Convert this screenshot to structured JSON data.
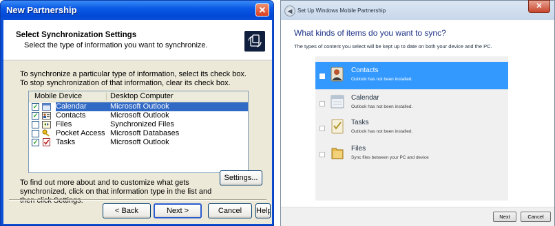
{
  "xp": {
    "title": "New Partnership",
    "close": "✕",
    "header_title": "Select Synchronization Settings",
    "header_subtitle": "Select the type of information you want to synchronize.",
    "instructions": "To synchronize a particular type of information, select its check box. To stop synchronization of that information, clear its check box.",
    "columns": [
      "Mobile Device",
      "Desktop Computer"
    ],
    "rows": [
      {
        "name": "Calendar",
        "app": "Microsoft Outlook",
        "checked": true,
        "selected": true,
        "icon": "calendar-icon"
      },
      {
        "name": "Contacts",
        "app": "Microsoft Outlook",
        "checked": true,
        "selected": false,
        "icon": "contacts-icon"
      },
      {
        "name": "Files",
        "app": "Synchronized Files",
        "checked": false,
        "selected": false,
        "icon": "files-icon"
      },
      {
        "name": "Pocket Access",
        "app": "Microsoft Databases",
        "checked": false,
        "selected": false,
        "icon": "pocket-access-icon"
      },
      {
        "name": "Tasks",
        "app": "Microsoft Outlook",
        "checked": true,
        "selected": false,
        "icon": "tasks-icon"
      }
    ],
    "find_out": "To find out more about and to customize what gets synchronized, click on that information type in the list and then click Settings.",
    "settings_button": "Settings...",
    "back_button": "< Back",
    "next_button": "Next >",
    "cancel_button": "Cancel",
    "help_button": "Help"
  },
  "w7": {
    "title": "Set Up Windows Mobile Partnership",
    "close": "✕",
    "heading": "What kinds of items do you want to sync?",
    "description": "The types of content you select will be kept up to date on both your device and the PC.",
    "items": [
      {
        "name": "Contacts",
        "sub": "Outlook has not been installed.",
        "selected": true,
        "icon": "contacts-icon"
      },
      {
        "name": "Calendar",
        "sub": "Outlook has not been installed.",
        "selected": false,
        "icon": "calendar-icon"
      },
      {
        "name": "Tasks",
        "sub": "Outlook has not been installed.",
        "selected": false,
        "icon": "tasks-icon"
      },
      {
        "name": "Files",
        "sub": "Sync files between your PC and device",
        "selected": false,
        "icon": "folder-icon"
      }
    ],
    "next_button": "Next",
    "cancel_button": "Cancel"
  },
  "colors": {
    "xp_blue": "#0a4fd8",
    "xp_selection": "#316ac5",
    "w7_selection": "#3399ff",
    "w7_heading": "#1e3287"
  }
}
